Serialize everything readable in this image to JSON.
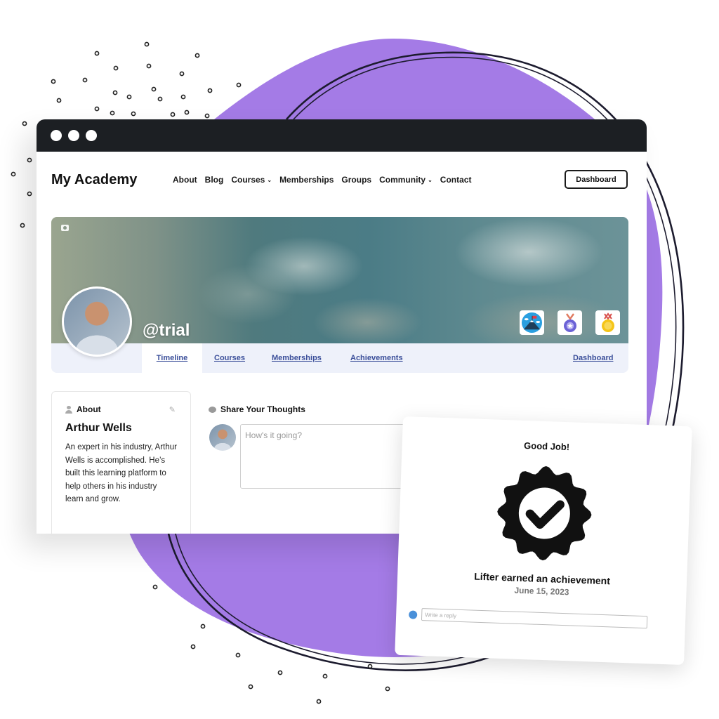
{
  "colors": {
    "blob": "#a47be6",
    "titlebar": "#1c1f23",
    "tab_link": "#3b4f9a",
    "tabs_bg": "#eef1fa"
  },
  "browser": {
    "window_controls": [
      "dot",
      "dot",
      "dot"
    ]
  },
  "site": {
    "logo": "My Academy",
    "nav": [
      {
        "label": "About",
        "has_dropdown": false
      },
      {
        "label": "Blog",
        "has_dropdown": false
      },
      {
        "label": "Courses",
        "has_dropdown": true
      },
      {
        "label": "Memberships",
        "has_dropdown": false
      },
      {
        "label": "Groups",
        "has_dropdown": false
      },
      {
        "label": "Community",
        "has_dropdown": true
      },
      {
        "label": "Contact",
        "has_dropdown": false
      }
    ],
    "chevron": "⌄",
    "dashboard_button": "Dashboard"
  },
  "profile": {
    "username": "@trial",
    "badges": [
      {
        "name": "mountain-flag-badge",
        "label": "Summit achievement"
      },
      {
        "name": "purple-medal-badge",
        "label": "Purple star medal"
      },
      {
        "name": "gold-medal-badge",
        "label": "Gold medal"
      }
    ],
    "tabs": [
      {
        "label": "Timeline",
        "active": true
      },
      {
        "label": "Courses",
        "active": false
      },
      {
        "label": "Memberships",
        "active": false
      },
      {
        "label": "Achievements",
        "active": false
      },
      {
        "label": "Dashboard",
        "active": false
      }
    ]
  },
  "about": {
    "heading": "About",
    "edit_icon": "✎",
    "name": "Arthur Wells",
    "bio": "An expert in his industry, Arthur Wells is accomplished. He’s built this learning platform to help others in his industry learn and grow."
  },
  "share": {
    "heading": "Share Your Thoughts",
    "placeholder": "How's it going?"
  },
  "achievement": {
    "title": "Good Job!",
    "text": "Lifter earned an achievement",
    "date": "June 15, 2023",
    "reply_placeholder": "Write a reply"
  }
}
